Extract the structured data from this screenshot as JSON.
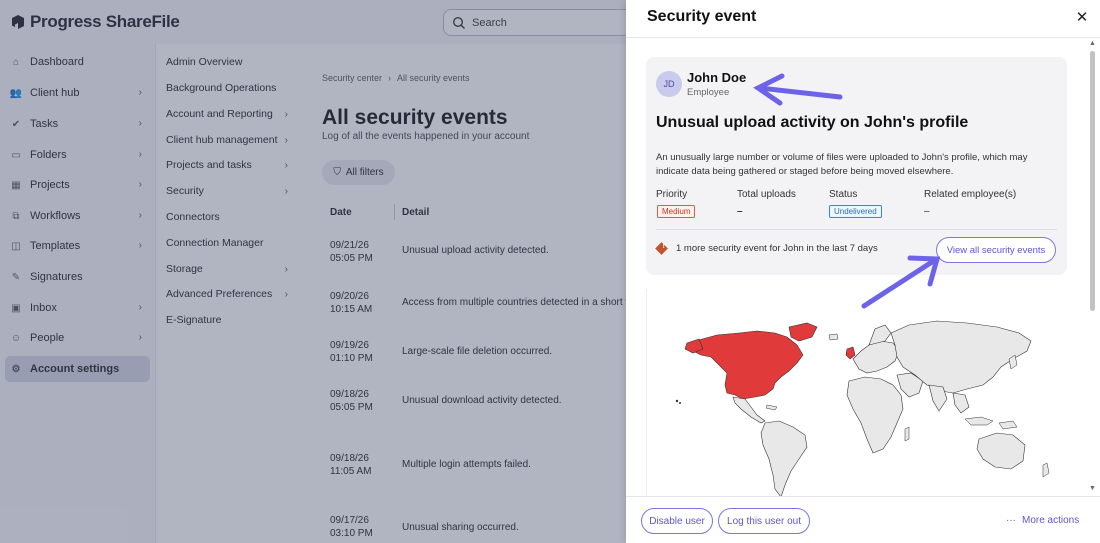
{
  "app": {
    "brand": "Progress ShareFile",
    "search_placeholder": "Search"
  },
  "sidebar": {
    "items": [
      {
        "label": "Dashboard",
        "icon": "home-icon",
        "chevron": false
      },
      {
        "label": "Client hub",
        "icon": "people-icon",
        "chevron": true
      },
      {
        "label": "Tasks",
        "icon": "check-icon",
        "chevron": true
      },
      {
        "label": "Folders",
        "icon": "folder-icon",
        "chevron": true
      },
      {
        "label": "Projects",
        "icon": "projects-icon",
        "chevron": true
      },
      {
        "label": "Workflows",
        "icon": "workflow-icon",
        "chevron": true
      },
      {
        "label": "Templates",
        "icon": "template-icon",
        "chevron": true
      },
      {
        "label": "Signatures",
        "icon": "pen-icon",
        "chevron": false
      },
      {
        "label": "Inbox",
        "icon": "inbox-icon",
        "chevron": true
      },
      {
        "label": "People",
        "icon": "person-icon",
        "chevron": true
      },
      {
        "label": "Account settings",
        "icon": "account-settings-icon",
        "chevron": false,
        "active": true
      }
    ]
  },
  "subnav": {
    "items": [
      {
        "label": "Admin Overview",
        "chevron": false
      },
      {
        "label": "Background Operations",
        "chevron": false
      },
      {
        "label": "Account and Reporting",
        "chevron": true
      },
      {
        "label": "Client hub management",
        "chevron": true
      },
      {
        "label": "Projects and tasks",
        "chevron": true
      },
      {
        "label": "Security",
        "chevron": true
      },
      {
        "label": "Connectors",
        "chevron": false
      },
      {
        "label": "Connection Manager",
        "chevron": false
      },
      {
        "label": "Storage",
        "chevron": true
      },
      {
        "label": "Advanced Preferences",
        "chevron": true
      },
      {
        "label": "E-Signature",
        "chevron": false
      }
    ]
  },
  "main": {
    "breadcrumb": [
      "Security center",
      "All security events"
    ],
    "title": "All security events",
    "subtitle": "Log of all the events happened in your account",
    "filters_label": "All filters",
    "columns": [
      "Date",
      "Detail"
    ],
    "rows": [
      {
        "date": "09/21/26\n05:05 PM",
        "detail": "Unusual upload activity detected."
      },
      {
        "date": "09/20/26\n10:15 AM",
        "detail": "Access from multiple countries detected in a short tim"
      },
      {
        "date": "09/19/26\n01:10 PM",
        "detail": "Large-scale file deletion occurred."
      },
      {
        "date": "09/18/26\n05:05 PM",
        "detail": "Unusual download activity detected."
      },
      {
        "date": "09/18/26\n11:05 AM",
        "detail": "Multiple login attempts failed."
      },
      {
        "date": "09/17/26\n03:10 PM",
        "detail": "Unusual sharing occurred."
      }
    ]
  },
  "drawer": {
    "title": "Security event",
    "user": {
      "initials": "JD",
      "name": "John Doe",
      "role": "Employee"
    },
    "event_title": "Unusual upload activity on John's profile",
    "description": "An unusually large number or volume of files were uploaded to John's profile, which may indicate data being gathered or staged before being moved elsewhere.",
    "fields": {
      "priority_label": "Priority",
      "priority_value": "Medium",
      "uploads_label": "Total uploads",
      "uploads_value": "–",
      "status_label": "Status",
      "status_value": "Undelivered",
      "related_label": "Related employee(s)",
      "related_value": "–"
    },
    "more_events_text": "1 more security event for John in the last 7 days",
    "view_all_label": "View all security events",
    "footer": {
      "disable_label": "Disable user",
      "logout_label": "Log this user out",
      "more_label": "More actions"
    }
  },
  "colors": {
    "accent": "#5c57cf",
    "highlight_region": "#e03a3a",
    "annotation_arrow": "#6c63e8"
  }
}
